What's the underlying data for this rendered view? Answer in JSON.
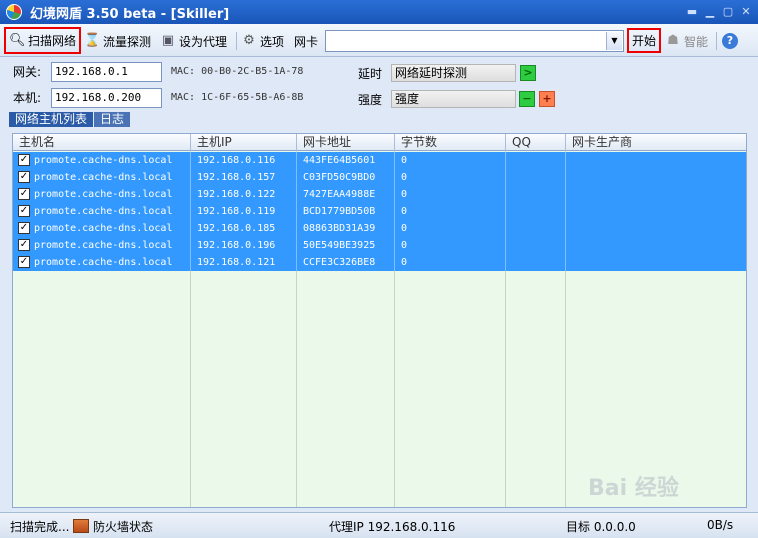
{
  "window": {
    "title": "幻境网盾  3.50 beta - [Skiller]",
    "controls": [
      "help-icon",
      "minimize-icon",
      "maximize-icon",
      "close-icon"
    ]
  },
  "toolbar": {
    "scan_label": "扫描网络",
    "traffic_label": "流量探测",
    "proxy_label": "设为代理",
    "options_label": "选项",
    "nic_label": "网卡",
    "nic_value": "",
    "start_label": "开始",
    "smart_label": "智能",
    "highlight_color": "#e00000"
  },
  "info": {
    "gateway_label": "网关:",
    "gateway_ip": "192.168.0.1",
    "gateway_mac": "MAC: 00-B0-2C-B5-1A-78",
    "local_label": "本机:",
    "local_ip": "192.168.0.200",
    "local_mac": "MAC: 1C-6F-65-5B-A6-8B",
    "latency_label": "延时",
    "latency_value": "网络延时探测",
    "strength_label": "强度",
    "strength_value": "强度",
    "go_symbol": ">",
    "minus_symbol": "−",
    "plus_symbol": "+"
  },
  "tabs": [
    {
      "label": "网络主机列表",
      "active": true
    },
    {
      "label": "日志",
      "active": false
    }
  ],
  "table": {
    "columns": [
      "主机名",
      "主机IP",
      "网卡地址",
      "字节数",
      "QQ",
      "网卡生产商"
    ],
    "rows": [
      {
        "checked": true,
        "host": "promote.cache-dns.local",
        "ip": "192.168.0.116",
        "mac": "443FE64B5601",
        "bytes": "0",
        "qq": "",
        "vendor": ""
      },
      {
        "checked": true,
        "host": "promote.cache-dns.local",
        "ip": "192.168.0.157",
        "mac": "C03FD50C9BD0",
        "bytes": "0",
        "qq": "",
        "vendor": ""
      },
      {
        "checked": true,
        "host": "promote.cache-dns.local",
        "ip": "192.168.0.122",
        "mac": "7427EAA4988E",
        "bytes": "0",
        "qq": "",
        "vendor": ""
      },
      {
        "checked": true,
        "host": "promote.cache-dns.local",
        "ip": "192.168.0.119",
        "mac": "BCD1779BD50B",
        "bytes": "0",
        "qq": "",
        "vendor": ""
      },
      {
        "checked": true,
        "host": "promote.cache-dns.local",
        "ip": "192.168.0.185",
        "mac": "08863BD31A39",
        "bytes": "0",
        "qq": "",
        "vendor": ""
      },
      {
        "checked": true,
        "host": "promote.cache-dns.local",
        "ip": "192.168.0.196",
        "mac": "50E549BE3925",
        "bytes": "0",
        "qq": "",
        "vendor": ""
      },
      {
        "checked": true,
        "host": "promote.cache-dns.local",
        "ip": "192.168.0.121",
        "mac": "CCFE3C326BE8",
        "bytes": "0",
        "qq": "",
        "vendor": ""
      }
    ],
    "selected_row_color": "#3399ff",
    "background_color": "#eaf9ea"
  },
  "statusbar": {
    "scan_status": "扫描完成...",
    "firewall_status": "防火墙状态",
    "proxy_ip": "代理IP 192.168.0.116",
    "target": "目标 0.0.0.0",
    "speed": "0B/s"
  },
  "watermark": "Bai 经验"
}
